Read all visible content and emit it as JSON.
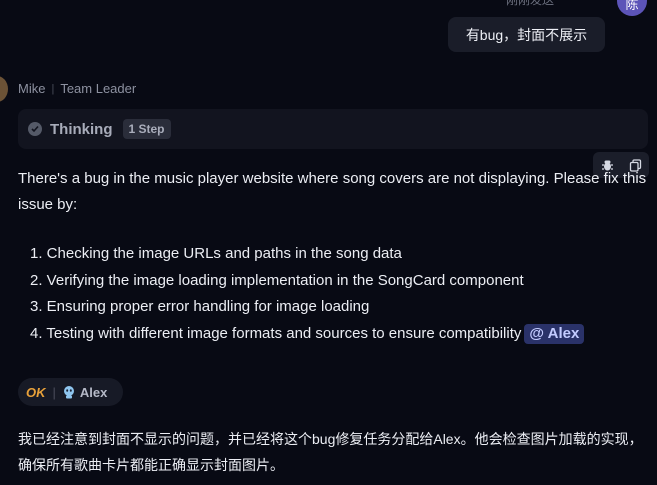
{
  "user_message": {
    "meta_text": "刚刚发送",
    "avatar_text": "陈",
    "text": "有bug，封面不展示"
  },
  "agent": {
    "name": "Mike",
    "role": "Team Leader",
    "thinking": {
      "label": "Thinking",
      "steps": "1 Step"
    },
    "intro": "There's a bug in the music player website where song covers are not displaying. Please fix this issue by:",
    "tasks": [
      "1. Checking the image URLs and paths in the song data",
      "2. Verifying the image loading implementation in the SongCard component",
      "3. Ensuring proper error handling for image loading",
      "4. Testing with different image formats and sources to ensure compatibility"
    ],
    "mention": "@ Alex"
  },
  "reply_tag": {
    "status": "OK",
    "assignee": "Alex"
  },
  "reply_text": "我已经注意到封面不显示的问题，并已经将这个bug修复任务分配给Alex。他会检查图片加载的实现，确保所有歌曲卡片都能正确显示封面图片。",
  "icons": [
    "check-icon",
    "bug-icon",
    "copy-icon",
    "robot-icon"
  ],
  "colors": {
    "background": "#080a14",
    "mention": "#2a3269",
    "ok": "#e8a13a",
    "avatar": "#5c54b8"
  }
}
